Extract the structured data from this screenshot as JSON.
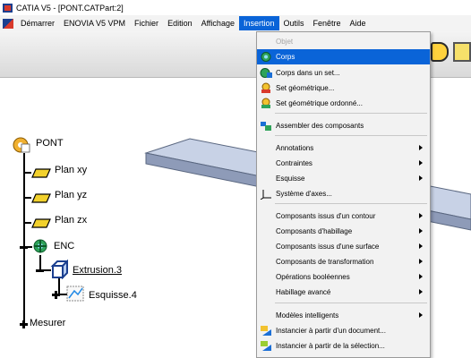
{
  "window": {
    "title": "CATIA V5 - [PONT.CATPart:2]"
  },
  "menubar": {
    "items": [
      "Démarrer",
      "ENOVIA V5 VPM",
      "Fichier",
      "Edition",
      "Affichage",
      "Insertion",
      "Outils",
      "Fenêtre",
      "Aide"
    ],
    "active_index": 5
  },
  "tree": {
    "root": "PONT",
    "plane_xy": "Plan xy",
    "plane_yz": "Plan yz",
    "plane_zx": "Plan zx",
    "body": "ENC",
    "extrusion": "Extrusion.3",
    "sketch": "Esquisse.4",
    "measure": "Mesurer"
  },
  "insertion_menu": {
    "items": [
      {
        "label": "Objet",
        "state": "disabled",
        "icon": "none",
        "submenu": false
      },
      {
        "label": "Corps",
        "state": "selected",
        "icon": "body-icon",
        "submenu": false
      },
      {
        "label": "Corps dans un set...",
        "state": "normal",
        "icon": "body-in-set-icon",
        "submenu": false
      },
      {
        "label": "Set géométrique...",
        "state": "normal",
        "icon": "geometric-set-icon",
        "submenu": false
      },
      {
        "label": "Set géométrique ordonné...",
        "state": "normal",
        "icon": "ordered-geometric-set-icon",
        "submenu": false
      },
      {
        "label": "Assembler des composants",
        "state": "normal",
        "icon": "assemble-icon",
        "submenu": false
      },
      {
        "label": "Annotations",
        "state": "normal",
        "icon": "none",
        "submenu": true
      },
      {
        "label": "Contraintes",
        "state": "normal",
        "icon": "none",
        "submenu": true
      },
      {
        "label": "Esquisse",
        "state": "normal",
        "icon": "none",
        "submenu": true
      },
      {
        "label": "Système d'axes...",
        "state": "normal",
        "icon": "axis-system-icon",
        "submenu": false
      },
      {
        "label": "Composants issus d'un contour",
        "state": "normal",
        "icon": "none",
        "submenu": true
      },
      {
        "label": "Composants d'habillage",
        "state": "normal",
        "icon": "none",
        "submenu": true
      },
      {
        "label": "Composants issus d'une surface",
        "state": "normal",
        "icon": "none",
        "submenu": true
      },
      {
        "label": "Composants de transformation",
        "state": "normal",
        "icon": "none",
        "submenu": true
      },
      {
        "label": "Opérations booléennes",
        "state": "normal",
        "icon": "none",
        "submenu": true
      },
      {
        "label": "Habillage avancé",
        "state": "normal",
        "icon": "none",
        "submenu": true
      },
      {
        "label": "Modèles intelligents",
        "state": "normal",
        "icon": "none",
        "submenu": true
      },
      {
        "label": "Instancier à partir d'un document...",
        "state": "normal",
        "icon": "instantiate-document-icon",
        "submenu": false
      },
      {
        "label": "Instancier à partir de la sélection...",
        "state": "normal",
        "icon": "instantiate-selection-icon",
        "submenu": false
      }
    ]
  },
  "colors": {
    "menu_highlight": "#0a64d8",
    "plate_top": "#c8d2e6",
    "plate_side": "#7d8aa8"
  }
}
